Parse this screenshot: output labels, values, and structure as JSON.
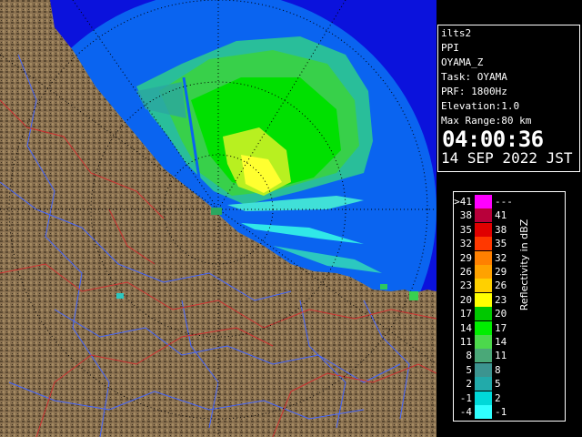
{
  "info": {
    "product": "ilts2",
    "mode": "PPI",
    "field": "OYAMA_Z",
    "task": "Task: OYAMA",
    "prf": "PRF: 1800Hz",
    "elevation": "Elevation:1.0",
    "max_range": "Max Range:80 km",
    "time": "04:00:36",
    "date": "14 SEP 2022 JST"
  },
  "legend": {
    "title": "Reflectivity in dBZ",
    "rows": [
      {
        "lo": ">41",
        "hi": "---",
        "color": "#ff00ff"
      },
      {
        "lo": "38",
        "hi": "41",
        "color": "#b8003a"
      },
      {
        "lo": "35",
        "hi": "38",
        "color": "#e00000"
      },
      {
        "lo": "32",
        "hi": "35",
        "color": "#ff3800"
      },
      {
        "lo": "29",
        "hi": "32",
        "color": "#ff8000"
      },
      {
        "lo": "26",
        "hi": "29",
        "color": "#ffa200"
      },
      {
        "lo": "23",
        "hi": "26",
        "color": "#ffd000"
      },
      {
        "lo": "20",
        "hi": "23",
        "color": "#ffff00"
      },
      {
        "lo": "17",
        "hi": "20",
        "color": "#00c800"
      },
      {
        "lo": "14",
        "hi": "17",
        "color": "#00ee00"
      },
      {
        "lo": "11",
        "hi": "14",
        "color": "#4cd84c"
      },
      {
        "lo": "8",
        "hi": "11",
        "color": "#4aa878"
      },
      {
        "lo": "5",
        "hi": "8",
        "color": "#3c9490"
      },
      {
        "lo": "2",
        "hi": "5",
        "color": "#22aaaa"
      },
      {
        "lo": "-1",
        "hi": "2",
        "color": "#00d8d8"
      },
      {
        "lo": "-4",
        "hi": "-1",
        "color": "#30ffff"
      }
    ]
  },
  "colors": {
    "coverage": "#0a64f0",
    "outer_ocean": "#0b12dc",
    "terrain": "#8a7150",
    "terrain_dark": "#5a4830",
    "rivers": "#4466ff",
    "borders": "#d03030"
  }
}
